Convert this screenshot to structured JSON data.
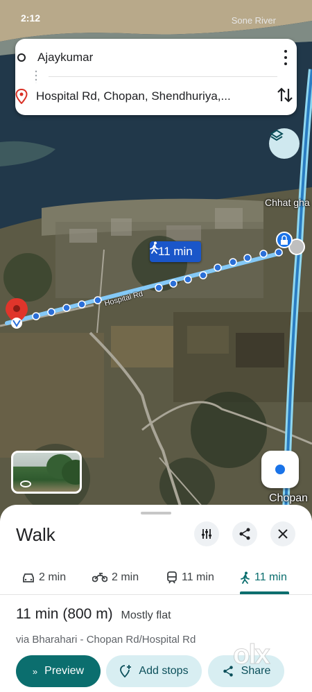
{
  "status_bar": {
    "time": "2:12",
    "right_label": "Sone River",
    "icons": "⚲ ▂▄▆ ▮"
  },
  "route": {
    "origin": "Ajaykumar",
    "destination": "Hospital Rd, Chopan, Shendhuriya,...",
    "more_icon": "more-vert-icon",
    "swap_icon": "swap-vert-icon"
  },
  "map": {
    "place_labels": [
      "Chhat gha",
      "Chopan"
    ],
    "road_label": "Hospital Rd",
    "route_chip": "11 min",
    "layers_icon": "layers-icon",
    "locate_icon": "my-location-icon",
    "colors": {
      "route": "#4a90f0",
      "chip": "#1a56c9",
      "pin": "#e0352b"
    }
  },
  "sheet": {
    "title": "Walk",
    "tabs": [
      {
        "icon": "car-icon",
        "label": "2 min"
      },
      {
        "icon": "motorbike-icon",
        "label": "2 min"
      },
      {
        "icon": "transit-icon",
        "label": "11 min"
      },
      {
        "icon": "walk-icon",
        "label": "11 min",
        "active": true
      }
    ],
    "summary_time": "11 min",
    "summary_distance": "(800 m)",
    "summary_note": "Mostly flat",
    "via": "via Bharahari - Chopan Rd/Hospital Rd",
    "actions": {
      "preview": "Preview",
      "add_stops": "Add stops",
      "share": "Share"
    },
    "accent": "#0b6e6e"
  },
  "watermark": "olx"
}
